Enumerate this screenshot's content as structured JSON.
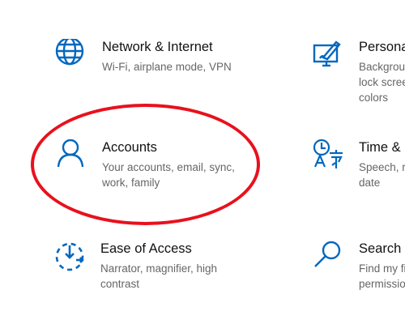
{
  "settings_tiles": [
    {
      "title": "Network & Internet",
      "description": "Wi-Fi, airplane mode, VPN",
      "icon": "globe-icon"
    },
    {
      "title": "Personalization",
      "description": "Background, lock screen, colors",
      "icon": "personalization-icon"
    },
    {
      "title": "Accounts",
      "description": "Your accounts, email, sync, work, family",
      "icon": "person-icon"
    },
    {
      "title": "Time & Language",
      "description": "Speech, region, date",
      "icon": "time-language-icon"
    },
    {
      "title": "Ease of Access",
      "description": "Narrator, magnifier, high contrast",
      "icon": "ease-of-access-icon"
    },
    {
      "title": "Search",
      "description": "Find my files, permissions",
      "icon": "search-icon"
    }
  ],
  "colors": {
    "icon_blue": "#0067c0",
    "highlight_red": "#e8111d",
    "title_text": "#111111",
    "description_text": "#666666"
  }
}
